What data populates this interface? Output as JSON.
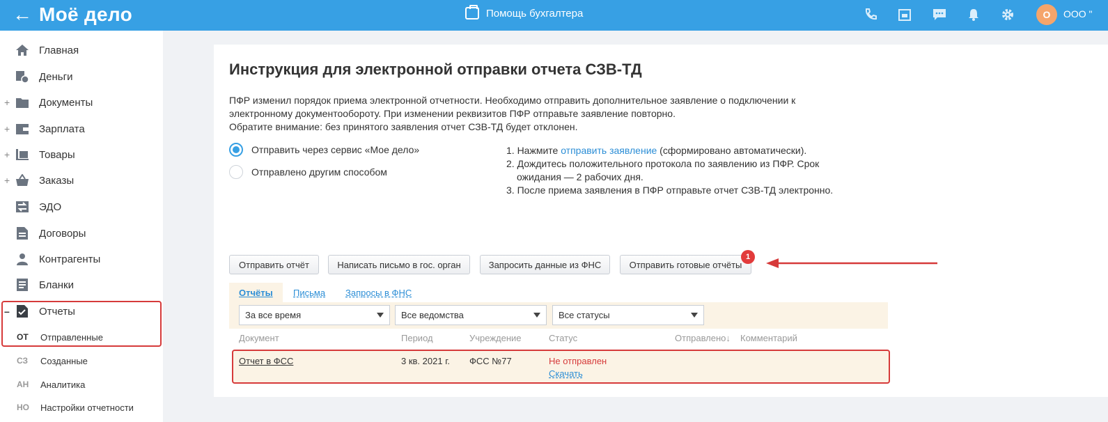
{
  "header": {
    "logo": "Моё дело",
    "help_label": "Помощь бухгалтера",
    "avatar_letter": "О",
    "org_name": "ООО \"",
    "icons": [
      "phone-icon",
      "calendar-icon",
      "chat-icon",
      "bell-icon",
      "gear-icon"
    ]
  },
  "sidebar": {
    "items": [
      {
        "label": "Главная",
        "icon": "home-icon",
        "expandable": false
      },
      {
        "label": "Деньги",
        "icon": "money-icon",
        "expandable": false
      },
      {
        "label": "Документы",
        "icon": "folder-icon",
        "expandable": true
      },
      {
        "label": "Зарплата",
        "icon": "wallet-icon",
        "expandable": true
      },
      {
        "label": "Товары",
        "icon": "goods-icon",
        "expandable": true
      },
      {
        "label": "Заказы",
        "icon": "basket-icon",
        "expandable": true
      },
      {
        "label": "ЭДО",
        "icon": "edo-icon",
        "expandable": false
      },
      {
        "label": "Договоры",
        "icon": "contract-icon",
        "expandable": false
      },
      {
        "label": "Контрагенты",
        "icon": "contractor-icon",
        "expandable": false
      },
      {
        "label": "Бланки",
        "icon": "forms-icon",
        "expandable": false
      },
      {
        "label": "Отчеты",
        "icon": "reports-icon",
        "expandable": true,
        "expanded": true
      }
    ],
    "sub_items": [
      {
        "abbr": "ОТ",
        "label": "Отправленные",
        "active": true
      },
      {
        "abbr": "СЗ",
        "label": "Созданные"
      },
      {
        "abbr": "АН",
        "label": "Аналитика"
      },
      {
        "abbr": "НО",
        "label": "Настройки отчетности"
      }
    ],
    "expanded_sign": "–",
    "collapsed_sign": "+"
  },
  "main": {
    "title": "Инструкция для электронной отправки отчета СЗВ-ТД",
    "notice_line1": "ПФР изменил порядок приема электронной отчетности. Необходимо отправить дополнительное заявление о подключении к",
    "notice_line2": "электронному документообороту. При изменении реквизитов ПФР отправьте заявление повторно.",
    "notice_line3": "Обратите внимание: без принятого заявления отчет СЗВ-ТД будет отклонен.",
    "radio_options": [
      {
        "label": "Отправить через сервис «Мое дело»",
        "selected": true
      },
      {
        "label": "Отправлено другим способом",
        "selected": false
      }
    ],
    "steps": {
      "s1_prefix": "1. Нажмите ",
      "s1_link": "отправить заявление",
      "s1_suffix": " (сформировано автоматически).",
      "s2_line1": "2. Дождитесь положительного протокола по заявлению из ПФР. Срок",
      "s2_line2": "ожидания — 2 рабочих дня.",
      "s3": "3. После приема заявления в ПФР отправьте отчет СЗВ-ТД электронно."
    },
    "buttons": {
      "send_report": "Отправить отчёт",
      "write_letter": "Написать письмо в гос. орган",
      "request_fns": "Запросить данные из ФНС",
      "send_ready": "Отправить готовые отчёты",
      "send_ready_badge": "1"
    },
    "tabs": [
      {
        "label": "Отчёты",
        "active": true
      },
      {
        "label": "Письма"
      },
      {
        "label": "Запросы в ФНС"
      }
    ],
    "filters": {
      "period": "За все время",
      "agency": "Все ведомства",
      "status": "Все статусы"
    },
    "table": {
      "headers": [
        "Документ",
        "Период",
        "Учреждение",
        "Статус",
        "Отправлено↓",
        "Комментарий"
      ],
      "rows": [
        {
          "document": "Отчет в ФСС",
          "period": "3 кв. 2021 г.",
          "agency": "ФСС №77",
          "status": "Не отправлен",
          "action": "Скачать",
          "sent": "",
          "comment": ""
        }
      ]
    },
    "colors": {
      "accent": "#37a0e4",
      "link": "#2c8ed6",
      "alert": "#d63a3a",
      "row_bg": "#fbf3e5"
    }
  }
}
